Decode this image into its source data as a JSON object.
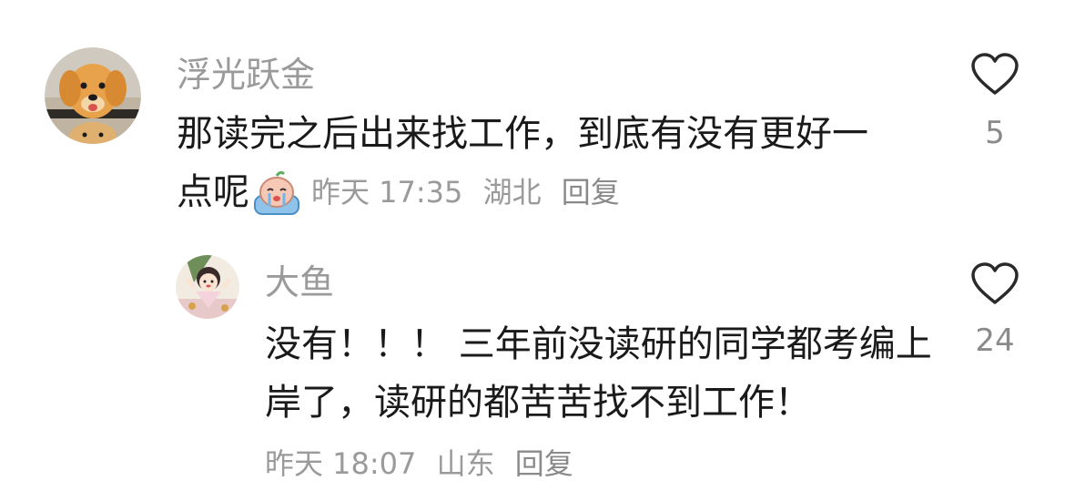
{
  "comments": [
    {
      "username": "浮光跃金",
      "text_line1": "那读完之后出来找工作，到底有没有更好一",
      "text_line2": "点呢",
      "emoji": "crying-emoji",
      "time": "昨天 17:35",
      "location": "湖北",
      "reply_label": "回复",
      "likes": "5"
    },
    {
      "username": "大鱼",
      "text_line1": "没有！！！ 三年前没读研的同学都考编上",
      "text_line2": "岸了，读研的都苦苦找不到工作！",
      "time": "昨天 18:07",
      "location": "山东",
      "reply_label": "回复",
      "likes": "24"
    }
  ],
  "icons": {
    "like": "heart-outline-icon"
  },
  "colors": {
    "username": "#9a9a9a",
    "text": "#1a1a1a",
    "meta": "#9a9a9a"
  }
}
